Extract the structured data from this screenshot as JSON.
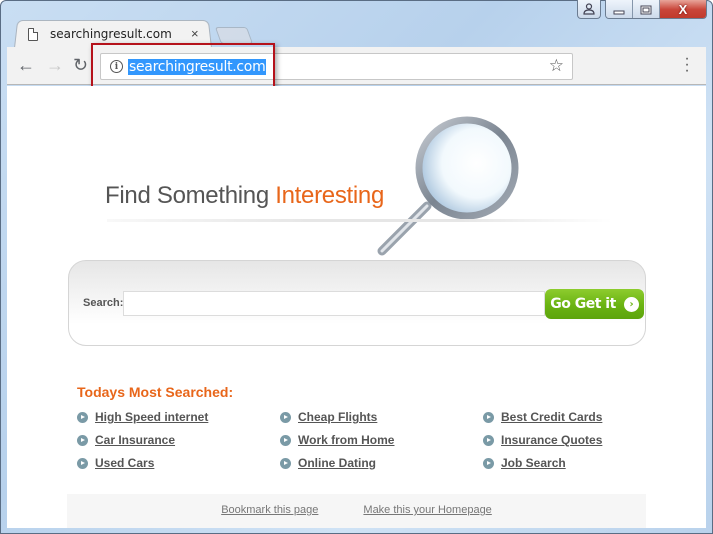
{
  "window": {
    "user_icon": "user-icon",
    "minimize_icon": "minimize-icon",
    "maximize_icon": "maximize-icon",
    "close_glyph": "X"
  },
  "tab": {
    "title": "searchingresult.com",
    "icon": "page-icon",
    "close_glyph": "×"
  },
  "toolbar": {
    "back_glyph": "←",
    "forward_glyph": "→",
    "reload_glyph": "↻",
    "info_glyph": "i",
    "url": "searchingresult.com",
    "star_glyph": "☆",
    "menu_glyph": "⋮"
  },
  "page": {
    "headline_plain": "Find Something ",
    "headline_accent": "Interesting",
    "search_label": "Search:",
    "search_value": "",
    "search_placeholder": "",
    "go_button": "Go Get it",
    "go_arrow": "›",
    "most_searched_title": "Todays Most Searched:",
    "links": [
      "High Speed internet",
      "Cheap Flights",
      "Best Credit Cards",
      "Car Insurance",
      "Work from Home",
      "Insurance Quotes",
      "Used Cars",
      "Online Dating",
      "Job Search"
    ],
    "footer": {
      "bookmark": "Bookmark this page",
      "homepage": "Make this your Homepage"
    }
  },
  "colors": {
    "accent_orange": "#e8661a",
    "button_green": "#6ab312",
    "url_highlight": "#3297fd",
    "annotation_red": "#b5121b"
  }
}
